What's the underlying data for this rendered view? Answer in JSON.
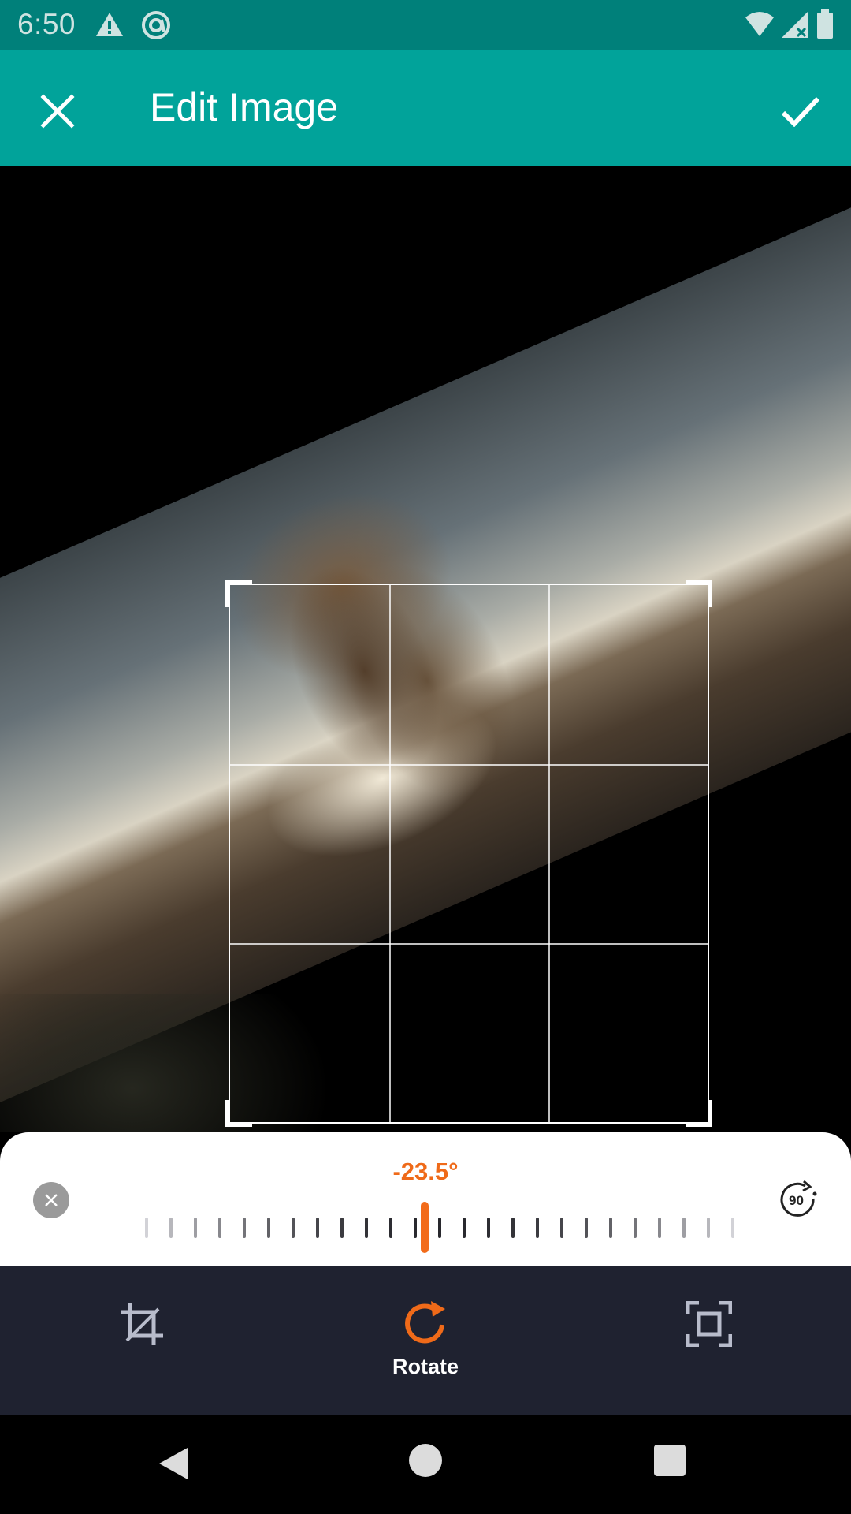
{
  "status_bar": {
    "time": "6:50",
    "icons": [
      "warning-icon",
      "at-sign-icon",
      "wifi-icon",
      "signal-icon",
      "battery-icon"
    ]
  },
  "toolbar": {
    "title": "Edit Image",
    "close_icon": "close-icon",
    "done_icon": "check-icon",
    "background": "#01a39a"
  },
  "rotate_panel": {
    "angle": "-23.5°",
    "angle_value": -23.5,
    "reset_icon": "reset-x-icon",
    "rotate90_label": "90",
    "accent": "#ef6a19"
  },
  "tools": [
    {
      "name": "crop",
      "icon": "crop-icon",
      "label": "",
      "active": false
    },
    {
      "name": "rotate",
      "icon": "rotate-icon",
      "label": "Rotate",
      "active": true
    },
    {
      "name": "fit",
      "icon": "fit-frame-icon",
      "label": "",
      "active": false
    }
  ],
  "nav_bar": {
    "icons": [
      "back-icon",
      "home-icon",
      "recents-icon"
    ]
  }
}
